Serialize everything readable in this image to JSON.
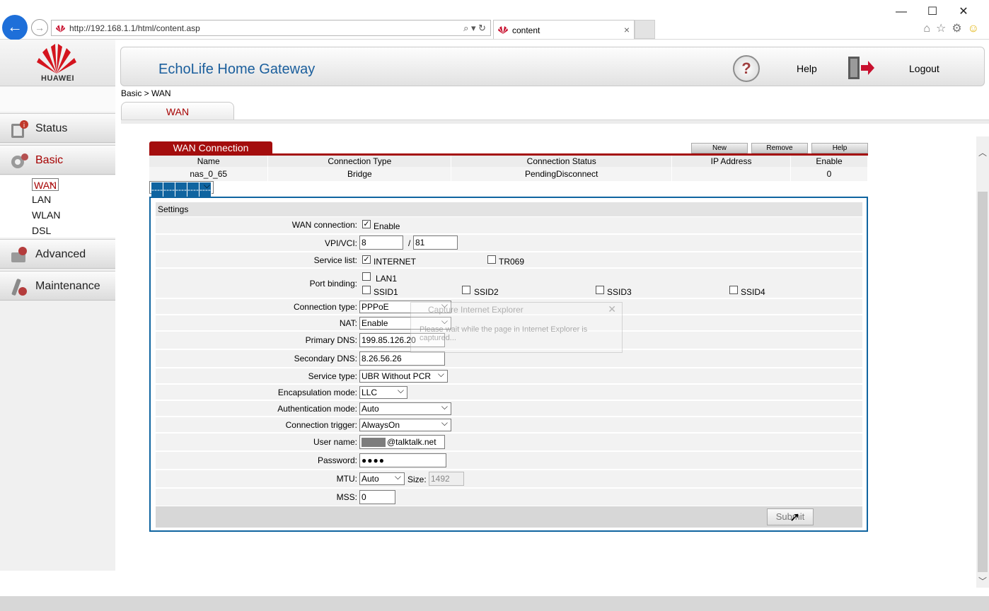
{
  "browser": {
    "url": "http://192.168.1.1/html/content.asp",
    "tab_title": "content",
    "tab_close": "×",
    "window_controls": [
      "—",
      "☐",
      "✕"
    ],
    "toolbar_icons": [
      "home-icon",
      "star-icon",
      "gear-icon",
      "smiley-icon"
    ]
  },
  "brand": {
    "logo_text": "HUAWEI",
    "accent": "#a60000",
    "blue": "#0f64a0"
  },
  "header": {
    "title": "EchoLife Home Gateway",
    "help_label": "Help",
    "logout_label": "Logout"
  },
  "nav": {
    "items": [
      {
        "label": "Status"
      },
      {
        "label": "Basic"
      },
      {
        "label": "Advanced"
      },
      {
        "label": "Maintenance"
      }
    ],
    "sub_items": [
      "WAN",
      "LAN",
      "WLAN",
      "DSL"
    ]
  },
  "breadcrumb": "Basic > WAN",
  "page_tab": "WAN",
  "wan": {
    "title": "WAN Connection",
    "buttons": {
      "new": "New",
      "remove": "Remove",
      "help": "Help"
    },
    "columns": [
      "Name",
      "Connection Type",
      "Connection Status",
      "IP Address",
      "Enable"
    ],
    "rows": [
      [
        "nas_0_65",
        "Bridge",
        "PendingDisconnect",
        "",
        "0"
      ],
      [
        "----",
        "----",
        "----",
        "----",
        "----"
      ]
    ]
  },
  "settings": {
    "title": "Settings",
    "wan_connection": {
      "label": "WAN connection:",
      "checkbox": "Enable",
      "checked": true
    },
    "vpi_vci": {
      "label": "VPI/VCI:",
      "vpi": "8",
      "sep": "/",
      "vci": "81"
    },
    "service_list": {
      "label": "Service list:",
      "options": [
        {
          "name": "INTERNET",
          "checked": true
        },
        {
          "name": "TR069",
          "checked": false
        }
      ]
    },
    "port_binding": {
      "label": "Port binding:",
      "ports": [
        "LAN1",
        "SSID1",
        "SSID2",
        "SSID3",
        "SSID4"
      ]
    },
    "connection_type": {
      "label": "Connection type:",
      "value": "PPPoE"
    },
    "nat": {
      "label": "NAT:",
      "value": "Enable"
    },
    "primary_dns": {
      "label": "Primary DNS:",
      "value": "199.85.126.20"
    },
    "secondary_dns": {
      "label": "Secondary DNS:",
      "value": "8.26.56.26"
    },
    "service_type": {
      "label": "Service type:",
      "value": "UBR Without PCR"
    },
    "encapsulation": {
      "label": "Encapsulation mode:",
      "value": "LLC"
    },
    "auth_mode": {
      "label": "Authentication mode:",
      "value": "Auto"
    },
    "conn_trigger": {
      "label": "Connection trigger:",
      "value": "AlwaysOn"
    },
    "username": {
      "label": "User name:",
      "value": "@talktalk.net"
    },
    "password": {
      "label": "Password:",
      "value": "●●●●"
    },
    "mtu": {
      "label": "MTU:",
      "value": "Auto",
      "size_label": "Size:",
      "size_value": "1492"
    },
    "mss": {
      "label": "MSS:",
      "value": "0"
    },
    "submit": "Submit"
  },
  "overlay": {
    "title": "Capture Internet Explorer",
    "message": "Please wait while the page in Internet Explorer is captured..."
  }
}
